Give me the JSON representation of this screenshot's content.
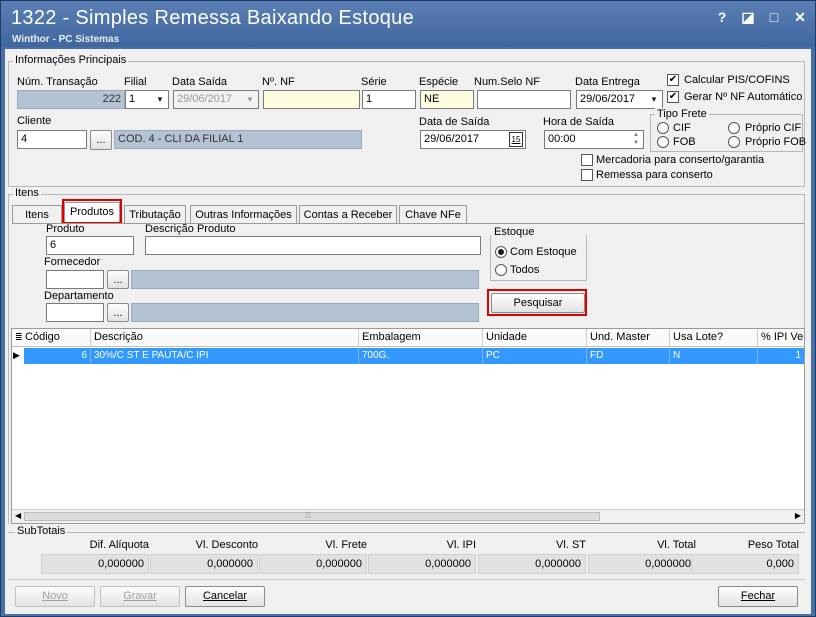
{
  "window": {
    "title": "1322 - Simples Remessa Baixando Estoque",
    "subtitle": "Winthor - PC Sistemas",
    "controls": {
      "help": "?",
      "minimize_restore": "◪",
      "maximize": "□",
      "close": "✕"
    }
  },
  "info": {
    "group_title": "Informações Principais",
    "num_transacao": {
      "label": "Núm. Transação",
      "value": "222"
    },
    "filial": {
      "label": "Filial",
      "value": "1"
    },
    "data_saida_top": {
      "label": "Data Saída",
      "value": "29/06/2017"
    },
    "num_nf": {
      "label": "Nº. NF",
      "value": ""
    },
    "serie": {
      "label": "Série",
      "value": "1"
    },
    "especie": {
      "label": "Espécie",
      "value": "NE"
    },
    "num_selo": {
      "label": "Num.Selo NF",
      "value": ""
    },
    "data_entrega": {
      "label": "Data Entrega",
      "value": "29/06/2017"
    },
    "calcular_pis": {
      "label": "Calcular PIS/COFINS",
      "checked": true
    },
    "gerar_nf": {
      "label": "Gerar Nº NF Automático",
      "checked": true
    },
    "cliente": {
      "label": "Cliente",
      "code": "4",
      "lookup_button": "...",
      "name": "COD. 4 - CLI DA FILIAL 1"
    },
    "data_de_saida": {
      "label": "Data de Saída",
      "value": "29/06/2017",
      "calendar_icon": "15"
    },
    "hora_saida": {
      "label": "Hora de Saída",
      "value": "00:00"
    },
    "tipo_frete": {
      "label": "Tipo Frete",
      "options": [
        "CIF",
        "Próprio CIF",
        "FOB",
        "Próprio FOB"
      ]
    },
    "mercadoria_conserto": {
      "label": "Mercadoria para conserto/garantia",
      "checked": false
    },
    "remessa_conserto": {
      "label": "Remessa para conserto",
      "checked": false
    }
  },
  "itens": {
    "group_title": "Itens",
    "tabs": [
      "Itens",
      "Produtos",
      "Tributação",
      "Outras Informações",
      "Contas a Receber",
      "Chave NFe"
    ],
    "active_tab": "Produtos",
    "produto": {
      "label": "Produto",
      "value": "6"
    },
    "descricao_produto": {
      "label": "Descrição Produto",
      "value": ""
    },
    "fornecedor": {
      "label": "Fornecedor",
      "value": "",
      "lookup_button": "..."
    },
    "departamento": {
      "label": "Departamento",
      "value": "",
      "lookup_button": "..."
    },
    "estoque": {
      "label": "Estoque",
      "options": [
        "Com Estoque",
        "Todos"
      ],
      "selected": "Com Estoque"
    },
    "pesquisar": "Pesquisar"
  },
  "grid": {
    "columns": [
      "Código",
      "Descrição",
      "Embalagem",
      "Unidade",
      "Und. Master",
      "Usa Lote?",
      "% IPI Ve"
    ],
    "rows": [
      {
        "codigo": "6",
        "descricao": "30%/C ST E PAUTA/C IPI",
        "embalagem": "700G.",
        "unidade": "PC",
        "und_master": "FD",
        "usa_lote": "N",
        "ipi": "1"
      }
    ],
    "selected_color": "#3399ff"
  },
  "subtotais": {
    "group_title": "SubTotais",
    "fields": [
      {
        "label": "Dif. Alíquota",
        "value": "0,000000"
      },
      {
        "label": "Vl. Desconto",
        "value": "0,000000"
      },
      {
        "label": "Vl. Frete",
        "value": "0,000000"
      },
      {
        "label": "Vl. IPI",
        "value": "0,000000"
      },
      {
        "label": "Vl. ST",
        "value": "0,000000"
      },
      {
        "label": "Vl. Total",
        "value": "0,000000"
      },
      {
        "label": "Peso Total",
        "value": "0,000"
      }
    ]
  },
  "footer": {
    "novo": "Novo",
    "gravar": "Gravar",
    "cancelar": "Cancelar",
    "fechar": "Fechar"
  }
}
